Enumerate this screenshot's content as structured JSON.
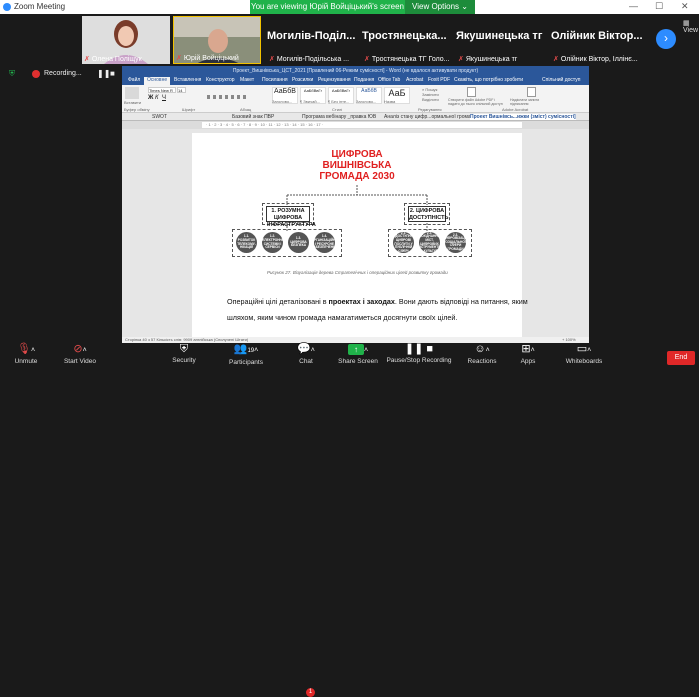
{
  "titlebar": {
    "app_name": "Zoom Meeting",
    "minimize": "—",
    "maximize": "☐",
    "close": "✕"
  },
  "share_banner": {
    "text": "You are viewing Юрій Войціцький's screen",
    "view_options": "View Options"
  },
  "gallery": {
    "participants": [
      {
        "name": "Олена Поліщук"
      },
      {
        "name": "Юрій Войціцький"
      },
      {
        "name": "Могилів-Поділ...",
        "subname": "Могилів-Подільська ..."
      },
      {
        "name": "Тростянецька...",
        "subname": "Тростянецька ТГ Голо..."
      },
      {
        "name": "Якушинецька тг",
        "subname": "Якушинецька тг"
      },
      {
        "name": "Олійник Віктор...",
        "subname": "Олійник Віктор, Іллінє..."
      }
    ],
    "view_label": "View"
  },
  "recording": {
    "label": "Recording..."
  },
  "word": {
    "title": "Проект_Вишнівська_ЦСТ_2021 [Правлений 06-Режим сумісності] - Word (не вдалося активувати продукт)",
    "tabs": [
      "Файл",
      "Основне",
      "Вставлення",
      "Конструктор",
      "Макет",
      "Посилання",
      "Розсилки",
      "Рецензування",
      "Подання",
      "Office Tab",
      "Acrobat",
      "Foxit PDF",
      "Скажіть, що потрібно зробити",
      "Спільний доступ"
    ],
    "ribbon": {
      "paste": "Вставити",
      "font_name": "Times New R",
      "font_size": "14",
      "styles": [
        "АаБбВ",
        "АаБбВвГг",
        "АаБбВвГг",
        "АаБбВ",
        "АаБ"
      ],
      "style_names": [
        "Заголово...",
        "¶ Звичай...",
        "¶ Без інте...",
        "Заголово...",
        "Назва"
      ],
      "find": "Пошук",
      "replace": "Замінити",
      "select": "Виділити",
      "pdf_create": "Створити файл Adobe PDF і надати до нього спільний доступ",
      "pdf_sign": "Надіслати запити підписання",
      "groups": [
        "Буфер обміну",
        "Шрифт",
        "Абзац",
        "Стилі",
        "Редагування",
        "Adobe Acrobat"
      ]
    },
    "doc_tabs": [
      "SWOT",
      "Базовий знак ПВР",
      "Програма вебінару _правка ЮВ",
      "Аналіз стану цифр...ормальної громади",
      "Проект Вишнівсь...ижки (зміст) сумісності]"
    ],
    "ruler_marks": "· 1 · 2 · 3 · 4 · 5 · 6 · 7 · 8 · 9 · 10 · 11 · 12 · 13 · 14 · 15 · 16 · 17 ·",
    "page": {
      "title": "ЦИФРОВА ВИШНІВСЬКА ГРОМАДА 2030",
      "box1": "1. РОЗУМНА ЦИФРОВА ІНФРАСТРУКТУРА",
      "box2": "2. ЦИФРОВА ДОСТУПНІСТЬ",
      "circles1": [
        "1.1. РОЗВИТОК ТЕЛЕКОМУ-НІКАЦІЙ",
        "1.2. ЕЛЕКТРОННІ СИСТЕМИ І СЕРВІСИ",
        "1.3. ЦИФРОВА БЕЗПЕКА",
        "1.4. ОРГАНІЗАЦІЙНЕ І РЕСУРСНЕ ЗАБЕЗПЕЧЕННЯ"
      ],
      "circles2": [
        "2.1. ДОСТУПНІ ЦИФРОВІ ПОСЛУГИ У ПУБЛІЧНІЙ СФЕРІ",
        "2.2. ПОЄДНАННЯ МІСТ, ЦИФРОВИХ ІНСТРУМЕНТІВ ТА КУЛЬТУРИ",
        "2.3. ЦИФРОВІЗАЦІЯ СОЦІАЛЬНОЇ СФЕРИ ГРОМАДИ"
      ],
      "caption": "Рисунок 27. Візуалізація дерева Стратегічних і операційних цілей розвитку громади",
      "body_line1_a": "Операційні цілі деталізовані в ",
      "body_line1_b": "проектах і заходах",
      "body_line1_c": ". Вони дають відповіді на питання, яким",
      "body_line2": "шляхом, яким чином громада намагатиметься досягнути своїх цілей."
    },
    "status": "Сторінка 40 з 57    Кількість слів: 9909    англійська (Сполучені Штати)",
    "zoom": "+ 100%"
  },
  "toolbar": {
    "unmute": "Unmute",
    "start_video": "Start Video",
    "security": "Security",
    "participants": "Participants",
    "participants_count": "19",
    "chat": "Chat",
    "chat_badge": "1",
    "share_screen": "Share Screen",
    "recording": "Pause/Stop Recording",
    "reactions": "Reactions",
    "apps": "Apps",
    "whiteboards": "Whiteboards",
    "end": "End"
  }
}
